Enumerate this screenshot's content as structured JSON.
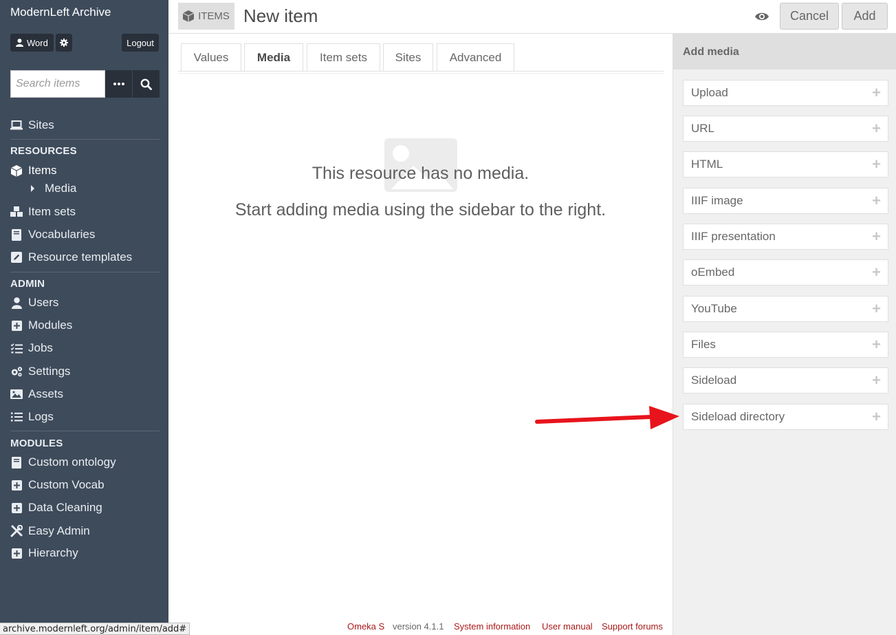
{
  "sidebar": {
    "site_title": "ModernLeft Archive",
    "user_name": "Word",
    "logout_label": "Logout",
    "search_placeholder": "Search items",
    "sites_label": "Sites",
    "resources_heading": "RESOURCES",
    "items_label": "Items",
    "media_label": "Media",
    "item_sets_label": "Item sets",
    "vocabularies_label": "Vocabularies",
    "resource_templates_label": "Resource templates",
    "admin_heading": "ADMIN",
    "users_label": "Users",
    "modules_label": "Modules",
    "jobs_label": "Jobs",
    "settings_label": "Settings",
    "assets_label": "Assets",
    "logs_label": "Logs",
    "modules_heading": "MODULES",
    "custom_ontology_label": "Custom ontology",
    "custom_vocab_label": "Custom Vocab",
    "data_cleaning_label": "Data Cleaning",
    "easy_admin_label": "Easy Admin",
    "hierarchy_label": "Hierarchy"
  },
  "header": {
    "badge_label": "ITEMS",
    "page_title": "New item",
    "cancel_label": "Cancel",
    "add_label": "Add"
  },
  "tabs": {
    "values": "Values",
    "media": "Media",
    "item_sets": "Item sets",
    "sites": "Sites",
    "advanced": "Advanced"
  },
  "empty_state": {
    "line1": "This resource has no media.",
    "line2": "Start adding media using the sidebar to the right."
  },
  "add_media": {
    "heading": "Add media",
    "plus": "+",
    "buttons": {
      "upload": "Upload",
      "url": "URL",
      "html": "HTML",
      "iiif_image": "IIIF image",
      "iiif_presentation": "IIIF presentation",
      "oembed": "oEmbed",
      "youtube": "YouTube",
      "files": "Files",
      "sideload": "Sideload",
      "sideload_directory": "Sideload directory"
    }
  },
  "footer": {
    "omeka_s": "Omeka S",
    "version": "version 4.1.1",
    "system_information": "System information",
    "user_manual": "User manual",
    "support_forums": "Support forums"
  },
  "status_url": "archive.modernleft.org/admin/item/add#",
  "colors": {
    "sidebar_bg": "#3e4b5b",
    "button_dark": "#29303a",
    "link_red": "#a91919",
    "arrow_red": "#e8141c"
  }
}
